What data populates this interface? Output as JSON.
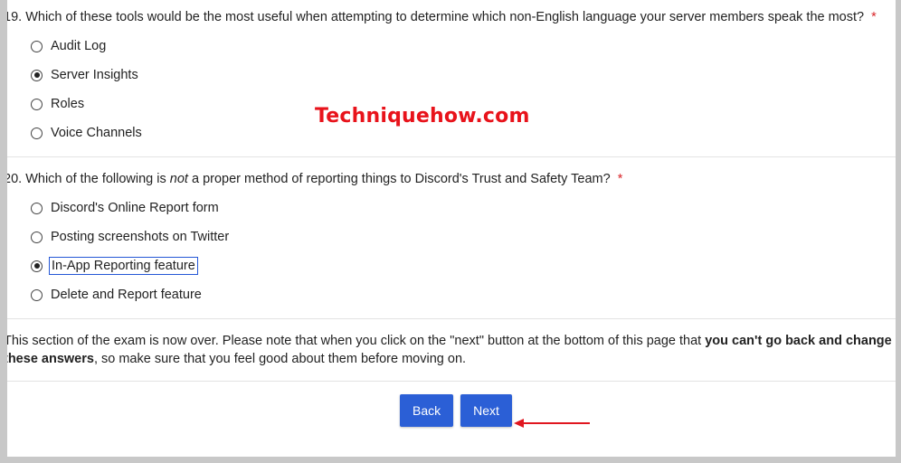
{
  "q19": {
    "number": "19.",
    "text": "Which of these tools would be the most useful when attempting to determine which non-English language your server members speak the most?",
    "required_mark": "*",
    "options": [
      "Audit Log",
      "Server Insights",
      "Roles",
      "Voice Channels"
    ],
    "selected": "Server Insights"
  },
  "q20": {
    "number": "20.",
    "text_before": "Which of the following is",
    "text_em": "not",
    "text_after": "a proper method of reporting things to Discord's Trust and Safety Team?",
    "required_mark": "*",
    "options": [
      "Discord's Online Report form",
      "Posting screenshots on Twitter",
      "In-App Reporting feature",
      "Delete and Report feature"
    ],
    "selected": "In-App Reporting feature"
  },
  "notice": {
    "part1": "This section of the exam is now over. Please note that when you click on the \"next\" button at the bottom of this page that",
    "bold": "you can't go back and change these answers",
    "part2": ", so make sure that you feel good about them before moving on."
  },
  "buttons": {
    "back": "Back",
    "next": "Next"
  },
  "watermark": "Techniquehow.com",
  "colors": {
    "button": "#2b5fd6",
    "required": "#d9262a",
    "watermark": "#e8131b",
    "arrow": "#e0161f"
  }
}
